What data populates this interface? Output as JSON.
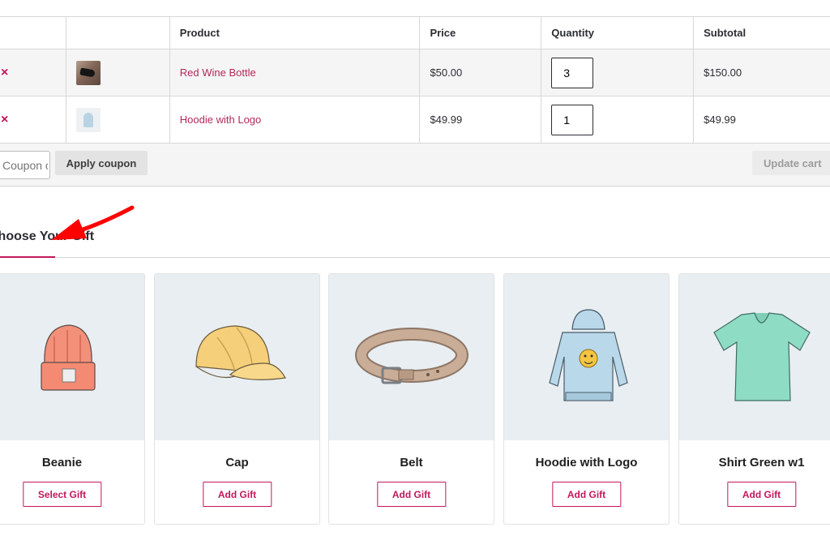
{
  "cart": {
    "headers": {
      "product": "Product",
      "price": "Price",
      "quantity": "Quantity",
      "subtotal": "Subtotal"
    },
    "items": [
      {
        "remove": "×",
        "name": "Red Wine Bottle",
        "price": "$50.00",
        "quantity": "3",
        "subtotal": "$150.00",
        "thumb": "wine-bottle-thumbnail"
      },
      {
        "remove": "×",
        "name": "Hoodie with Logo",
        "price": "$49.99",
        "quantity": "1",
        "subtotal": "$49.99",
        "thumb": "hoodie-thumbnail"
      }
    ],
    "coupon_placeholder": "Coupon code",
    "apply_label": "Apply coupon",
    "update_label": "Update cart"
  },
  "gift": {
    "heading": "Choose Your Gift",
    "accent": "#c2185b",
    "products": [
      {
        "name": "Beanie",
        "button": "Select Gift",
        "icon": "beanie-image"
      },
      {
        "name": "Cap",
        "button": "Add Gift",
        "icon": "cap-image"
      },
      {
        "name": "Belt",
        "button": "Add Gift",
        "icon": "belt-image"
      },
      {
        "name": "Hoodie with Logo",
        "button": "Add Gift",
        "icon": "hoodie-image"
      },
      {
        "name": "Shirt Green w1",
        "button": "Add Gift",
        "icon": "shirt-image"
      }
    ]
  },
  "annotation": {
    "icon": "red-arrow-pointer",
    "color": "#ff0000"
  }
}
